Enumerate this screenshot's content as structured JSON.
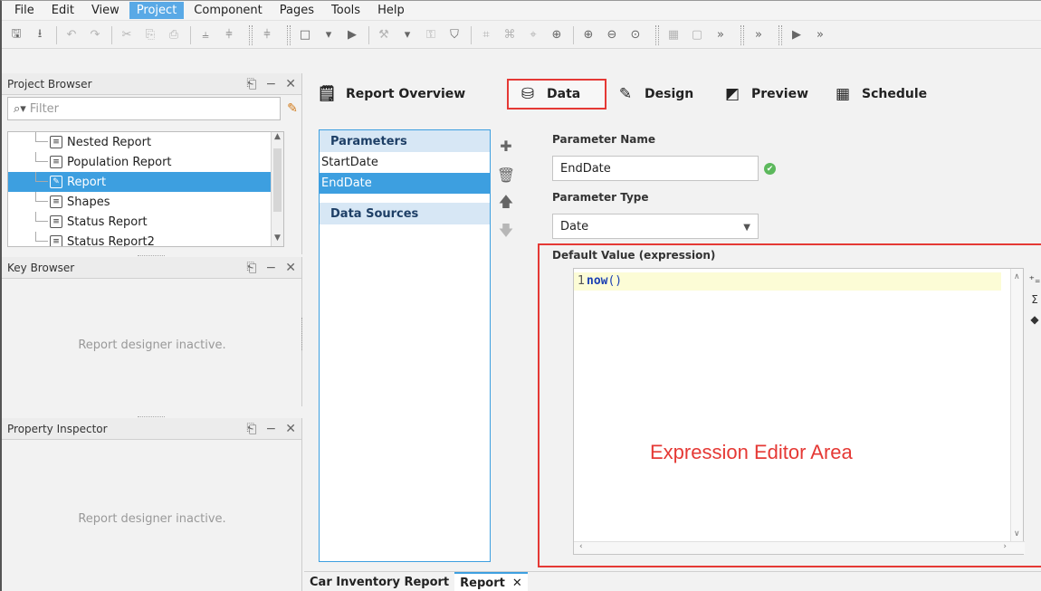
{
  "menu": [
    "File",
    "Edit",
    "View",
    "Project",
    "Component",
    "Pages",
    "Tools",
    "Help"
  ],
  "menu_active": "Project",
  "toolbar_icons": [
    {
      "name": "save-icon",
      "glyph": "🖫",
      "light": false
    },
    {
      "name": "import-icon",
      "glyph": "⭳",
      "light": false
    },
    {
      "name": "sep"
    },
    {
      "name": "undo-icon",
      "glyph": "↶",
      "light": true
    },
    {
      "name": "redo-icon",
      "glyph": "↷",
      "light": true
    },
    {
      "name": "sep"
    },
    {
      "name": "cut-icon",
      "glyph": "✂",
      "light": true
    },
    {
      "name": "copy-icon",
      "glyph": "⎘",
      "light": true
    },
    {
      "name": "paste-icon",
      "glyph": "⎙",
      "light": true
    },
    {
      "name": "sep"
    },
    {
      "name": "align-icon",
      "glyph": "⫨",
      "light": false
    },
    {
      "name": "distribute-icon",
      "glyph": "⫩",
      "light": false
    },
    {
      "name": "grip"
    },
    {
      "name": "align-left-icon",
      "glyph": "⫩",
      "light": false
    },
    {
      "name": "grip"
    },
    {
      "name": "window-icon",
      "glyph": "□",
      "light": false
    },
    {
      "name": "dropdown-icon",
      "glyph": "▾",
      "light": false
    },
    {
      "name": "play-icon",
      "glyph": "▶",
      "light": false
    },
    {
      "name": "sep"
    },
    {
      "name": "wrench-icon",
      "glyph": "⚒",
      "light": true
    },
    {
      "name": "dropdown-icon",
      "glyph": "▾",
      "light": false
    },
    {
      "name": "key-icon",
      "glyph": "⚿",
      "light": true
    },
    {
      "name": "shield-icon",
      "glyph": "⛉",
      "light": false
    },
    {
      "name": "sep"
    },
    {
      "name": "group-icon",
      "glyph": "⌗",
      "light": true
    },
    {
      "name": "ungroup-icon",
      "glyph": "⌘",
      "light": true
    },
    {
      "name": "layout-icon",
      "glyph": "⌖",
      "light": true
    },
    {
      "name": "anchor-icon",
      "glyph": "⊕",
      "light": false
    },
    {
      "name": "sep"
    },
    {
      "name": "zoom-in-icon",
      "glyph": "⊕",
      "light": false
    },
    {
      "name": "zoom-out-icon",
      "glyph": "⊖",
      "light": false
    },
    {
      "name": "zoom-reset-icon",
      "glyph": "⊙",
      "light": false
    },
    {
      "name": "grip"
    },
    {
      "name": "snap-icon",
      "glyph": "▦",
      "light": true
    },
    {
      "name": "frame-icon",
      "glyph": "▢",
      "light": true
    },
    {
      "name": "overflow-icon",
      "glyph": "»",
      "light": false
    },
    {
      "name": "grip"
    },
    {
      "name": "overflow-icon",
      "glyph": "»",
      "light": false
    },
    {
      "name": "grip"
    },
    {
      "name": "run-icon",
      "glyph": "▶",
      "light": false
    },
    {
      "name": "overflow-icon",
      "glyph": "»",
      "light": false
    }
  ],
  "project_browser": {
    "title": "Project Browser",
    "filter_placeholder": "Filter",
    "items": [
      {
        "label": "Nested Report",
        "selected": false,
        "icon": "report-icon"
      },
      {
        "label": "Population Report",
        "selected": false,
        "icon": "report-icon"
      },
      {
        "label": "Report",
        "selected": true,
        "icon": "report-edit-icon"
      },
      {
        "label": "Shapes",
        "selected": false,
        "icon": "report-icon"
      },
      {
        "label": "Status Report",
        "selected": false,
        "icon": "report-icon"
      },
      {
        "label": "Status Report2",
        "selected": false,
        "icon": "report-icon"
      }
    ]
  },
  "key_browser": {
    "title": "Key Browser",
    "message": "Report designer inactive."
  },
  "property_inspector": {
    "title": "Property Inspector",
    "message": "Report designer inactive."
  },
  "tabs": [
    {
      "label": "Report Overview",
      "icon": "report-overview-icon",
      "glyph": "🗒",
      "highlight": false
    },
    {
      "label": "Data",
      "icon": "database-icon",
      "glyph": "⛁",
      "highlight": true
    },
    {
      "label": "Design",
      "icon": "design-icon",
      "glyph": "✎",
      "highlight": false
    },
    {
      "label": "Preview",
      "icon": "preview-icon",
      "glyph": "◩",
      "highlight": false
    },
    {
      "label": "Schedule",
      "icon": "calendar-icon",
      "glyph": "▦",
      "highlight": false
    }
  ],
  "parameters": {
    "header": "Parameters",
    "items": [
      {
        "label": "StartDate",
        "selected": false
      },
      {
        "label": "EndDate",
        "selected": true
      }
    ],
    "data_sources_header": "Data Sources"
  },
  "form": {
    "name_label": "Parameter Name",
    "name_value": "EndDate",
    "type_label": "Parameter Type",
    "type_value": "Date",
    "default_label": "Default Value (expression)",
    "line_number": "1",
    "code_fn": "now",
    "code_parens": "()"
  },
  "annotation": "Expression Editor Area",
  "bottom_tabs": [
    {
      "label": "Car Inventory Report",
      "active": false
    },
    {
      "label": "Report",
      "active": true
    }
  ],
  "colors": {
    "accent": "#3d9fe0",
    "highlight_red": "#e53935"
  }
}
